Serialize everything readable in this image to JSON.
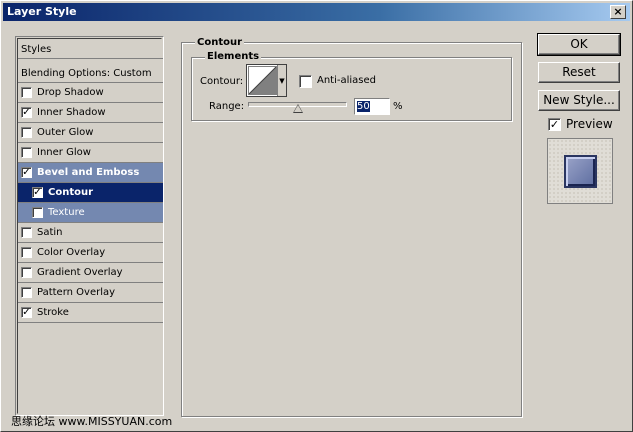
{
  "window": {
    "title": "Layer Style",
    "close_glyph": "×"
  },
  "styles": {
    "header": "Styles",
    "blending": "Blending Options: Custom",
    "items": [
      {
        "label": "Drop Shadow",
        "checked": false
      },
      {
        "label": "Inner Shadow",
        "checked": true
      },
      {
        "label": "Outer Glow",
        "checked": false
      },
      {
        "label": "Inner Glow",
        "checked": false
      },
      {
        "label": "Bevel and Emboss",
        "checked": true
      },
      {
        "label": "Contour",
        "checked": true
      },
      {
        "label": "Texture",
        "checked": false
      },
      {
        "label": "Satin",
        "checked": false
      },
      {
        "label": "Color Overlay",
        "checked": false
      },
      {
        "label": "Gradient Overlay",
        "checked": false
      },
      {
        "label": "Pattern Overlay",
        "checked": false
      },
      {
        "label": "Stroke",
        "checked": true
      }
    ]
  },
  "panel": {
    "title": "Contour",
    "elements_title": "Elements",
    "contour_label": "Contour:",
    "anti_aliased_label": "Anti-aliased",
    "anti_aliased": false,
    "range_label": "Range:",
    "range_value": "50",
    "range_unit": "%"
  },
  "buttons": {
    "ok": "OK",
    "reset": "Reset",
    "new_style": "New Style...",
    "preview_label": "Preview",
    "preview_checked": true
  },
  "watermark": "思缘论坛   www.MISSYUAN.com",
  "check_glyph": "✓",
  "colors": {
    "selected": "#0a246a",
    "group_highlight": "#7488b0",
    "title_start": "#0a246a"
  }
}
